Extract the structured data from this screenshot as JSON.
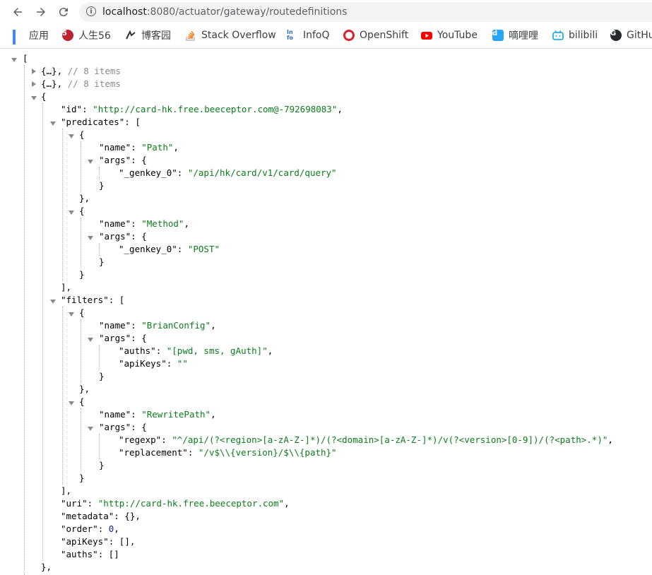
{
  "browser": {
    "url_host": "localhost",
    "url_rest": ":8080/actuator/gateway/routedefinitions",
    "info_icon": "info-icon",
    "bookmarks": [
      {
        "label": "应用",
        "icon": "apps-grid-icon",
        "color": "#4285f4"
      },
      {
        "label": "人生56",
        "icon": "rensheng-icon",
        "color": "#c0222e"
      },
      {
        "label": "博客园",
        "icon": "cnblogs-icon",
        "color": "#333333"
      },
      {
        "label": "Stack Overflow",
        "icon": "stackoverflow-icon",
        "color": "#f48024"
      },
      {
        "label": "InfoQ",
        "icon": "infoq-icon",
        "color": "#2f6db5"
      },
      {
        "label": "OpenShift",
        "icon": "openshift-icon",
        "color": "#db212e"
      },
      {
        "label": "YouTube",
        "icon": "youtube-icon",
        "color": "#ff0000"
      },
      {
        "label": "嘀哩哩",
        "icon": "dilidili-icon",
        "color": "#2aa4f4"
      },
      {
        "label": "bilibili",
        "icon": "bilibili-icon",
        "color": "#23ade5"
      },
      {
        "label": "GitHu",
        "icon": "github-icon",
        "color": "#24292e"
      }
    ]
  },
  "json": {
    "l0": "[",
    "c1_a": "{…}",
    "c1_b": ", ",
    "c1_c": "// 8 items",
    "c2_a": "{…}",
    "c2_b": ", ",
    "c2_c": "// 8 items",
    "l3": "{",
    "id_key": "\"id\"",
    "id_val": "\"http://card-hk.free.beeceptor.com@-792698083\"",
    "pred_key": "\"predicates\"",
    "open_bracket": "[",
    "open_brace": "{",
    "name_key": "\"name\"",
    "args_key": "\"args\"",
    "genkey_key": "\"_genkey_0\"",
    "p1_name": "\"Path\"",
    "p1_genkey": "\"/api/hk/card/v1/card/query\"",
    "p2_name": "\"Method\"",
    "p2_genkey": "\"POST\"",
    "close_brace": "}",
    "close_brace_comma": "},",
    "close_bracket_comma": "],",
    "filters_key": "\"filters\"",
    "f1_name": "\"BrianConfig\"",
    "auths_key": "\"auths\"",
    "f1_auths": "\"[pwd, sms, gAuth]\"",
    "apikeys_key": "\"apiKeys\"",
    "f1_apikeys": "\"\"",
    "f2_name": "\"RewritePath\"",
    "regexp_key": "\"regexp\"",
    "f2_regexp": "\"^/api/(?<region>[a-zA-Z-]*)/(?<domain>[a-zA-Z-]*)/v(?<version>[0-9])/(?<path>.*)\"",
    "replacement_key": "\"replacement\"",
    "f2_replacement": "\"/v$\\\\{version}/$\\\\{path}\"",
    "uri_key": "\"uri\"",
    "uri_val": "\"http://card-hk.free.beeceptor.com\"",
    "metadata_key": "\"metadata\"",
    "metadata_val": "{}",
    "order_key": "\"order\"",
    "order_val": "0",
    "apikeys_val": "[]",
    "auths_val": "[]",
    "last_close": "},"
  },
  "colors": {
    "string": "#0b7d1a",
    "number": "#1a1aa6",
    "comment": "#8a8a8a"
  }
}
